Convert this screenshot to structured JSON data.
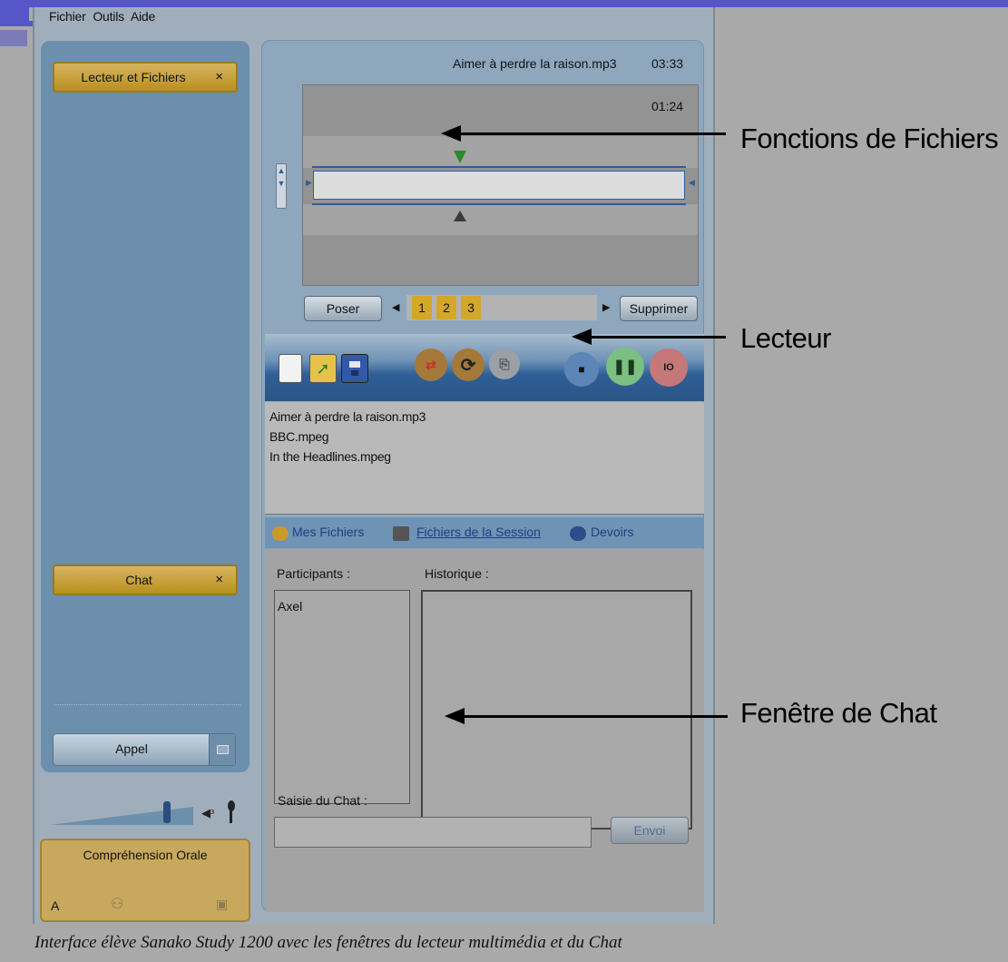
{
  "menu": [
    "Fichier",
    "Outils",
    "Aide"
  ],
  "left": {
    "tab_player": "Lecteur et Fichiers",
    "tab_chat": "Chat",
    "close": "×",
    "appel": "Appel",
    "comprehension": {
      "title": "Compréhension Orale",
      "level": "A"
    }
  },
  "player": {
    "filename": "Aimer à perdre la raison.mp3",
    "duration": "03:33",
    "position": "01:24",
    "poser": "Poser",
    "marks": [
      "1",
      "2",
      "3"
    ],
    "supprimer": "Supprimer"
  },
  "files": [
    "Aimer à perdre la raison.mp3",
    "BBC.mpeg",
    "In the Headlines.mpeg"
  ],
  "tabs": [
    "Mes Fichiers",
    "Fichiers de la Session",
    "Devoirs"
  ],
  "chat": {
    "participants_label": "Participants :",
    "history_label": "Historique :",
    "participants": [
      "Axel"
    ],
    "input_label": "Saisie du Chat :",
    "send": "Envoi"
  },
  "annotations": {
    "files": "Fonctions de Fichiers",
    "player": "Lecteur",
    "chat": "Fenêtre de Chat"
  },
  "caption": "Interface élève Sanako Study 1200 avec les fenêtres du lecteur multimédia et du Chat",
  "colors": {
    "accent_blue": "#2f5f97",
    "tab_gold": "#c7a85c",
    "panel_blue": "#6b8fad"
  }
}
